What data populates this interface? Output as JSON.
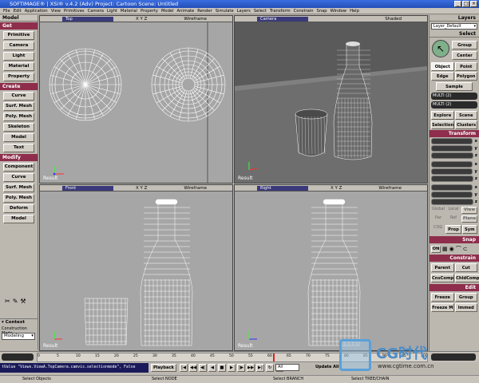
{
  "title": "SOFTIMAGE® | XSI® v.4.2 (Adv) Project: Cartoon    Scene: Untitled",
  "menu": [
    "File",
    "Edit",
    "Application",
    "View",
    "Primitives",
    "Camera",
    "Light",
    "Material",
    "Property",
    "Model",
    "Animate",
    "Render",
    "Simulate",
    "Layers",
    "Select",
    "Transform",
    "Constrain",
    "Snap",
    "Window",
    "Help"
  ],
  "left": {
    "tab": "Model",
    "get_header": "Get",
    "get_items": [
      "Primitive",
      "Camera",
      "Light",
      "Material",
      "Property"
    ],
    "create_header": "Create",
    "create_items": [
      "Curve",
      "Surf. Mesh",
      "Poly. Mesh",
      "Skeleton",
      "Model",
      "Text"
    ],
    "modify_header": "Modify",
    "modify_items": [
      "Component",
      "Curve",
      "Surf. Mesh",
      "Poly. Mesh",
      "Deform",
      "Model"
    ],
    "context_header": "Context",
    "construction_mode_label": "Construction Mode",
    "construction_mode_value": "Modeling"
  },
  "viewports": [
    {
      "name": "Top",
      "xyz": "X Y Z",
      "mode": "Wireframe",
      "label": "Result"
    },
    {
      "name": "Camera",
      "xyz": "",
      "mode": "Shaded",
      "label": "Result"
    },
    {
      "name": "Front",
      "xyz": "X Y Z",
      "mode": "Wireframe",
      "label": "Result"
    },
    {
      "name": "Right",
      "xyz": "X Y Z",
      "mode": "Wireframe",
      "label": "Result"
    }
  ],
  "right": {
    "layers_header": "Layers",
    "layer_value": "Layer_Default",
    "select_header": "Select",
    "group": "Group",
    "center": "Center",
    "object": "Object",
    "point": "Point",
    "edge": "Edge",
    "polygon": "Polygon",
    "sample": "Sample",
    "multi1": "MULTI (2)",
    "multi2": "MULTI (2)",
    "explore": "Explore",
    "scene": "Scene",
    "selection": "Selection",
    "clusters": "Clusters",
    "transform_header": "Transform",
    "tfields": [
      "x",
      "y",
      "z",
      "x",
      "y",
      "z",
      "x",
      "y",
      "z"
    ],
    "global": "Global",
    "local": "Local",
    "view": "View",
    "par": "Par",
    "ref": "Ref",
    "plane": "Plane",
    "cog": "COG",
    "prop": "Prop",
    "sym": "Sym",
    "snap_header": "Snap",
    "snap_on": "ON",
    "constrain_header": "Constrain",
    "parent": "Parent",
    "cut": "Cut",
    "cnscomp": "CnsComp",
    "childcomp": "ChldComp",
    "edit_header": "Edit",
    "freeze": "Freeze",
    "group2": "Group",
    "freeze_m": "Freeze M",
    "immed": "Immed"
  },
  "timeline": {
    "marks": [
      "0",
      "5",
      "10",
      "15",
      "20",
      "25",
      "30",
      "35",
      "40",
      "45",
      "50",
      "55",
      "60",
      "65",
      "70",
      "75",
      "80",
      "85",
      "90",
      "95",
      "100"
    ],
    "start": "1",
    "end": "100",
    "current": "1"
  },
  "script_line": "tValue \"Views.ViewA.TopCamera.camvis.selectionmode\", False",
  "playback": "Playback",
  "all": "All",
  "update_all": "Update All",
  "status": [
    "Select Objects",
    "Select NODE",
    "Select BRANCH",
    "Select TREE/CHAIN"
  ],
  "watermark": {
    "brand": "CG时代",
    "url": "www.cgtime.com.cn"
  },
  "colors": {
    "section": "#8e2e4c",
    "viewport_bg": "#a6a6a6",
    "titlebar": "#2f5fd0",
    "wire": "#ffffff"
  }
}
